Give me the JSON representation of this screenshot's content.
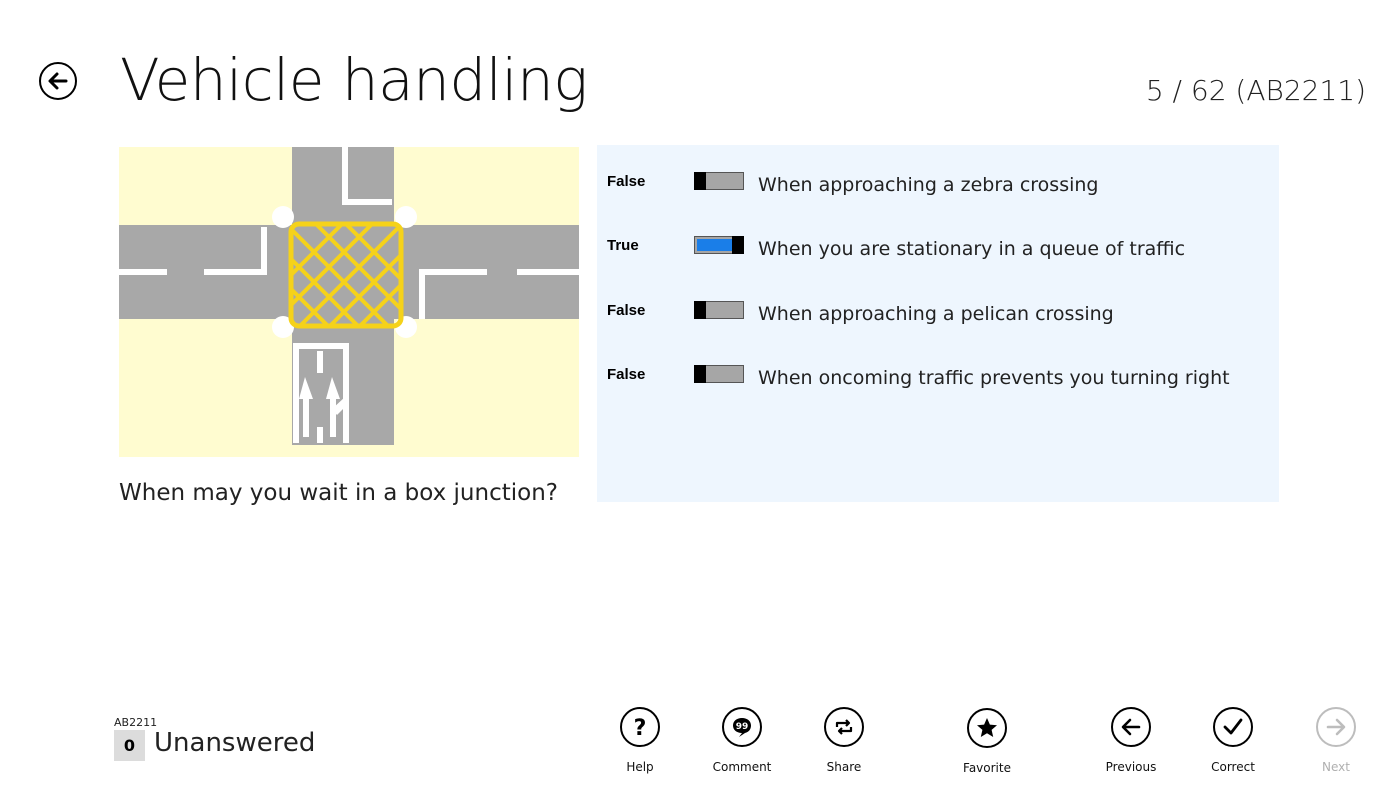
{
  "header": {
    "title": "Vehicle handling",
    "counter": "5 / 62 (AB2211)",
    "back_icon": "back-arrow-icon"
  },
  "question": {
    "text": "When may you wait in a box junction?",
    "image": "box-junction-diagram"
  },
  "answers": [
    {
      "state": "False",
      "text": "When approaching a zebra crossing",
      "on": false
    },
    {
      "state": "True",
      "text": "When you are stationary in a queue of traffic",
      "on": true
    },
    {
      "state": "False",
      "text": "When approaching a pelican crossing",
      "on": false
    },
    {
      "state": "False",
      "text": "When oncoming traffic prevents you turning right",
      "on": false
    }
  ],
  "status": {
    "code": "AB2211",
    "count": "0",
    "label": "Unanswered"
  },
  "appbar": {
    "help": "Help",
    "comment": "Comment",
    "share": "Share",
    "favorite": "Favorite",
    "previous": "Previous",
    "correct": "Correct",
    "next": "Next"
  },
  "colors": {
    "answer_panel": "#eef6fe",
    "toggle_on": "#1a7ee8",
    "box_junction": "#f5d21a",
    "pavement": "#fffcd0",
    "road": "#a8a8a8"
  }
}
